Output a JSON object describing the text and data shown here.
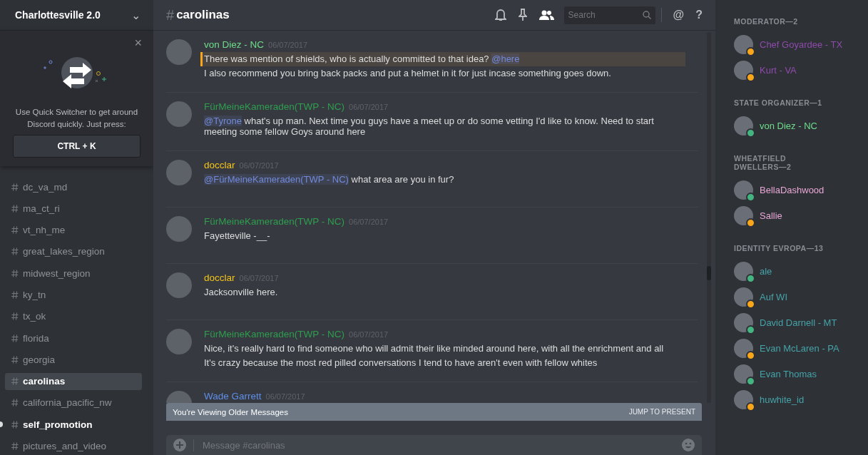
{
  "server": {
    "name": "Charlottesville 2.0",
    "chevron": "⌄"
  },
  "quick_switcher": {
    "close": "×",
    "text": "Use Quick Switcher to get around Discord quickly. Just press:",
    "shortcut": "CTRL + K"
  },
  "channels": [
    {
      "name": "dc_va_md",
      "selected": false,
      "unread": false
    },
    {
      "name": "ma_ct_ri",
      "selected": false,
      "unread": false
    },
    {
      "name": "vt_nh_me",
      "selected": false,
      "unread": false
    },
    {
      "name": "great_lakes_region",
      "selected": false,
      "unread": false
    },
    {
      "name": "midwest_region",
      "selected": false,
      "unread": false
    },
    {
      "name": "ky_tn",
      "selected": false,
      "unread": false
    },
    {
      "name": "tx_ok",
      "selected": false,
      "unread": false
    },
    {
      "name": "florida",
      "selected": false,
      "unread": false
    },
    {
      "name": "georgia",
      "selected": false,
      "unread": false
    },
    {
      "name": "carolinas",
      "selected": true,
      "unread": false
    },
    {
      "name": "california_pacific_nw",
      "selected": false,
      "unread": false
    },
    {
      "name": "self_promotion",
      "selected": false,
      "unread": true
    },
    {
      "name": "pictures_and_video",
      "selected": false,
      "unread": false
    }
  ],
  "channel_header": {
    "hash": "#",
    "name": "carolinas",
    "search_placeholder": "Search",
    "at": "@",
    "help": "?"
  },
  "messages": [
    {
      "author": "von Diez - NC",
      "color": "#6fdc8c",
      "time": "06/07/2017",
      "lines": [
        {
          "highlighted": true,
          "parts": [
            {
              "kind": "text",
              "text": "There was mention of shields, who is actually committed to that idea? "
            },
            {
              "kind": "mention",
              "text": "@here"
            }
          ]
        },
        {
          "highlighted": false,
          "parts": [
            {
              "kind": "text",
              "text": "I also recommend you bring back packs and put a helmet in it for just incase something goes down."
            }
          ]
        }
      ]
    },
    {
      "author": "FürMeineKameraden(TWP - NC)",
      "color": "#2e9e4f",
      "time": "06/07/2017",
      "lines": [
        {
          "highlighted": false,
          "parts": [
            {
              "kind": "mention",
              "text": "@Tyrone"
            },
            {
              "kind": "text",
              "text": "  what's up man. Next time you guys have a meet up or do some vetting I'd like to know. Need to start meeting some fellow Goys around here"
            }
          ]
        }
      ]
    },
    {
      "author": "docclar",
      "color": "#f5c518",
      "time": "06/07/2017",
      "lines": [
        {
          "highlighted": false,
          "parts": [
            {
              "kind": "mention",
              "text": "@FürMeineKameraden(TWP - NC)"
            },
            {
              "kind": "text",
              "text": " what area are you in fur?"
            }
          ]
        }
      ]
    },
    {
      "author": "FürMeineKameraden(TWP - NC)",
      "color": "#2e9e4f",
      "time": "06/07/2017",
      "lines": [
        {
          "highlighted": false,
          "parts": [
            {
              "kind": "text",
              "text": "Fayetteville  -__-"
            }
          ]
        }
      ]
    },
    {
      "author": "docclar",
      "color": "#f5c518",
      "time": "06/07/2017",
      "lines": [
        {
          "highlighted": false,
          "parts": [
            {
              "kind": "text",
              "text": "Jacksonville here."
            }
          ]
        }
      ]
    },
    {
      "author": "FürMeineKameraden(TWP - NC)",
      "color": "#2e9e4f",
      "time": "06/07/2017",
      "lines": [
        {
          "highlighted": false,
          "parts": [
            {
              "kind": "text",
              "text": "Nice, it's really hard to find someone who will admit their like minded around here, with all the enrichment and all"
            }
          ]
        },
        {
          "highlighted": false,
          "parts": [
            {
              "kind": "text",
              "text": "It's crazy because the most red pilled conversations I tend to have aren't even with fellow whites"
            }
          ]
        }
      ]
    },
    {
      "author": "Wade Garrett",
      "color": "#5f8fe8",
      "time": "06/07/2017"
    }
  ],
  "older_banner": {
    "text": "You're Viewing Older Messages",
    "action": "JUMP TO PRESENT"
  },
  "composer": {
    "placeholder": "Message #carolinas"
  },
  "member_groups": [
    {
      "title": "MODERATOR—2",
      "members": [
        {
          "name": "Chef Goyardee - TX",
          "color": "#8e4bab",
          "online": false
        },
        {
          "name": "Kurt - VA",
          "color": "#8e4bab",
          "online": false
        }
      ]
    },
    {
      "title": "STATE ORGANIZER—1",
      "members": [
        {
          "name": "von Diez - NC",
          "color": "#6fdc8c",
          "online": true
        }
      ]
    },
    {
      "title": "WHEATFIELD DWELLERS—2",
      "members": [
        {
          "name": "BellaDashwood",
          "color": "#e9a7d6",
          "online": true
        },
        {
          "name": "Sallie",
          "color": "#e9a7d6",
          "online": false
        }
      ]
    },
    {
      "title": "IDENTITY EVROPA—13",
      "members": [
        {
          "name": "ale",
          "color": "#45a3a8",
          "online": true
        },
        {
          "name": "Auf WI",
          "color": "#45a3a8",
          "online": false
        },
        {
          "name": "David Darnell - MT",
          "color": "#45a3a8",
          "online": true
        },
        {
          "name": "Evan McLaren - PA",
          "color": "#45a3a8",
          "online": false
        },
        {
          "name": "Evan Thomas",
          "color": "#45a3a8",
          "online": true
        },
        {
          "name": "huwhite_id",
          "color": "#45a3a8",
          "online": false
        }
      ]
    }
  ]
}
